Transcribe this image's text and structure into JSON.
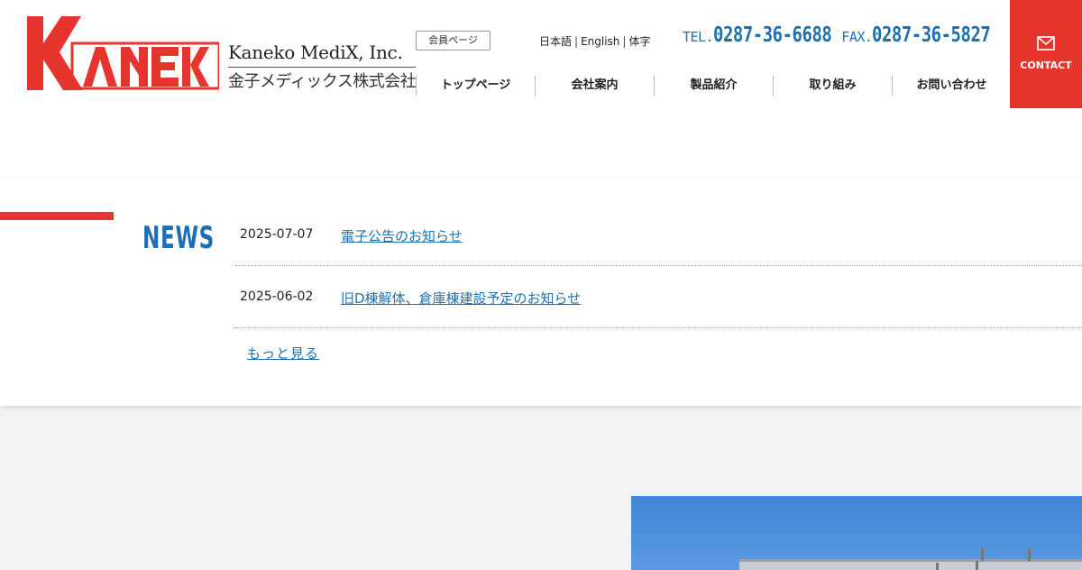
{
  "header": {
    "logo": {
      "mark_text": "KANEKO",
      "name_en": "Kaneko MediX, Inc.",
      "name_ja": "金子メディックス株式会社"
    },
    "member_button": "会員ページ",
    "languages": [
      "日本語",
      "English",
      "体字"
    ],
    "tel_label": "TEL.",
    "tel": "0287-36-6688",
    "fax_label": "FAX.",
    "fax": "0287-36-5827",
    "nav": [
      "トップページ",
      "会社案内",
      "製品紹介",
      "取り組み",
      "お問い合わせ"
    ],
    "contact_label": "CONTACT"
  },
  "news": {
    "title": "NEWS",
    "items": [
      {
        "date": "2025-07-07",
        "title": "電子公告のお知らせ"
      },
      {
        "date": "2025-06-02",
        "title": "旧D棟解体、倉庫棟建設予定のお知らせ"
      }
    ],
    "more_label": "もっと見る"
  },
  "colors": {
    "accent_red": "#e5352d",
    "link_blue": "#1f6fb0"
  }
}
